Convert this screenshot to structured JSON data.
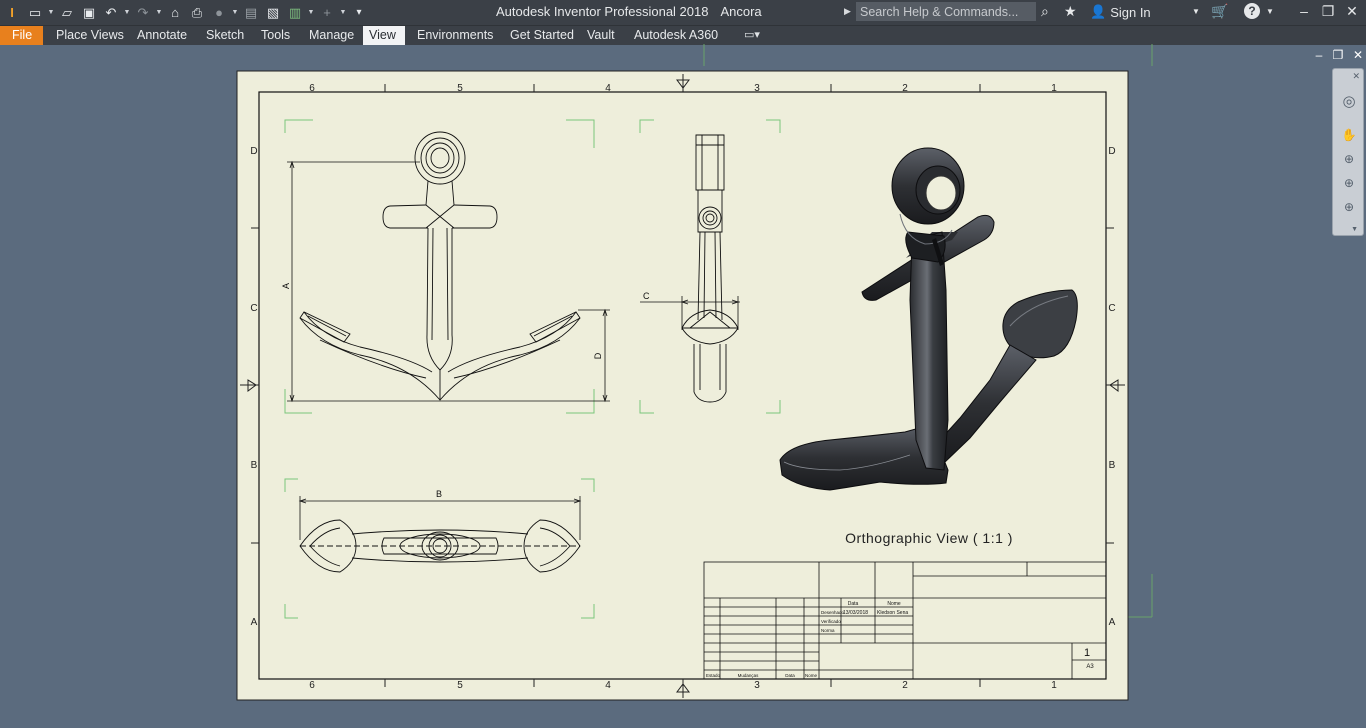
{
  "app": {
    "title": "Autodesk Inventor Professional 2018",
    "document": "Ancora",
    "search_placeholder": "Search Help & Commands...",
    "sign_in": "Sign In",
    "help_icon": "?"
  },
  "menu": {
    "file": "File",
    "tabs": [
      "Place Views",
      "Annotate",
      "Sketch",
      "Tools",
      "Manage",
      "View",
      "Environments",
      "Get Started",
      "Vault",
      "Autodesk A360"
    ],
    "active_tab": "View"
  },
  "sheet": {
    "col_labels": [
      "6",
      "5",
      "4",
      "3",
      "2",
      "1"
    ],
    "row_labels": [
      "D",
      "C",
      "B",
      "A"
    ]
  },
  "views": {
    "dim_a": "A",
    "dim_b": "B",
    "dim_c": "C",
    "dim_d": "D",
    "view_label": "Orthographic View  ( 1:1 )"
  },
  "title_block": {
    "data_header": "Data",
    "nome_header": "Nome",
    "row1_label": "Desenhado",
    "row1_date": "13/03/2018",
    "row1_name": "Kledson Sena",
    "row2_label": "Verificado",
    "row3_label": "Norma",
    "sheet_number": "1",
    "paper_size": "A3",
    "bottom_cells": [
      "Estado",
      "Mudanças",
      "Data",
      "Nome"
    ]
  },
  "colors": {
    "paper": "#eeeedb",
    "background": "#5b6b7e",
    "title_bar": "#3b4047",
    "file_tab": "#e8801d",
    "view_corner": "#7bc67b"
  }
}
